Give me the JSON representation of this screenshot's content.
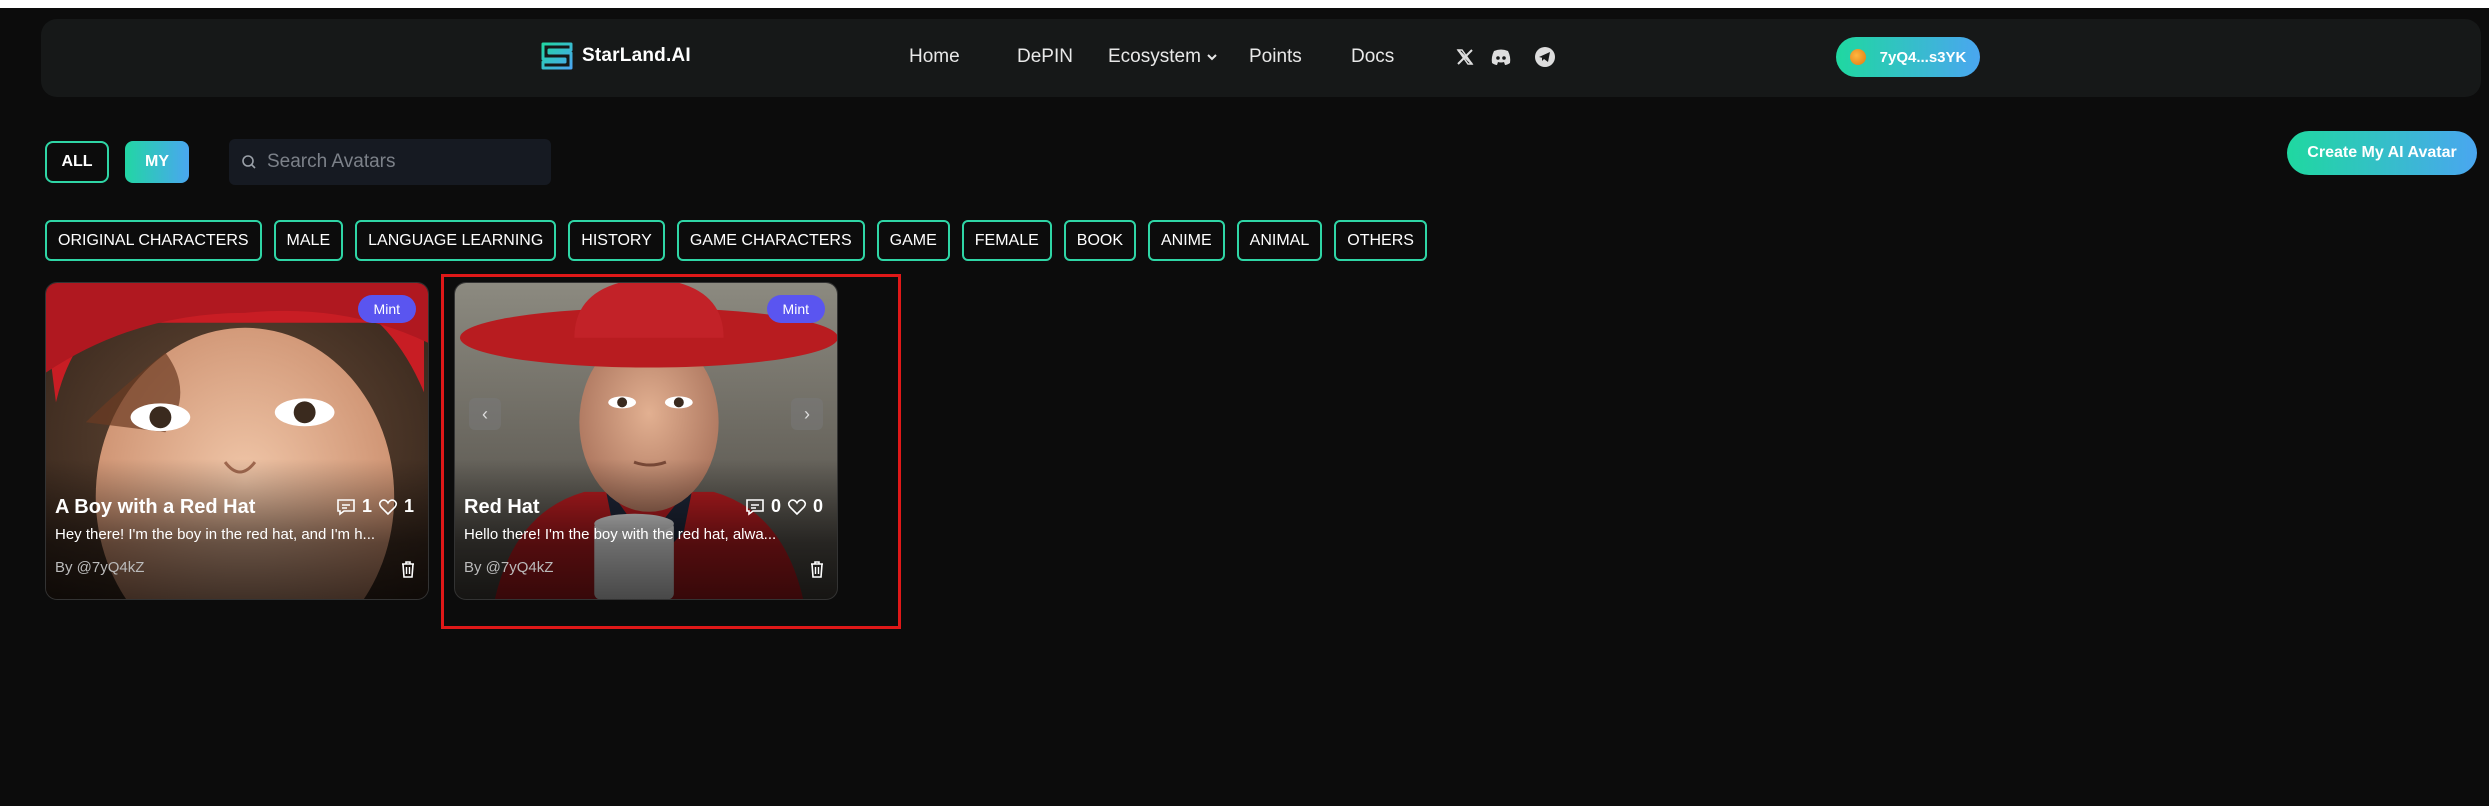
{
  "header": {
    "logo_text": "StarLand.AI",
    "nav": {
      "home": "Home",
      "depin": "DePIN",
      "ecosystem": "Ecosystem",
      "points": "Points",
      "docs": "Docs"
    },
    "wallet_label": "7yQ4...s3YK"
  },
  "filters": {
    "all_label": "ALL",
    "my_label": "MY",
    "search_placeholder": "Search Avatars",
    "create_button": "Create My AI Avatar"
  },
  "categories": [
    "ORIGINAL CHARACTERS",
    "MALE",
    "LANGUAGE LEARNING",
    "HISTORY",
    "GAME CHARACTERS",
    "GAME",
    "FEMALE",
    "BOOK",
    "ANIME",
    "ANIMAL",
    "OTHERS"
  ],
  "cards": [
    {
      "badge": "Mint",
      "title": "A Boy with a Red Hat",
      "comments": "1",
      "likes": "1",
      "description": "Hey there! I'm the boy in the red hat, and I'm h...",
      "author": "By @7yQ4kZ"
    },
    {
      "badge": "Mint",
      "title": "Red Hat",
      "comments": "0",
      "likes": "0",
      "description": "Hello there! I'm the boy with the red hat, alwa...",
      "author": "By @7yQ4kZ"
    }
  ],
  "colors": {
    "accent_green": "#2fd6a6",
    "accent_blue": "#4aa6f0",
    "mint_badge": "#5a55f0",
    "highlight": "#e01818",
    "background": "#0c0c0c"
  }
}
